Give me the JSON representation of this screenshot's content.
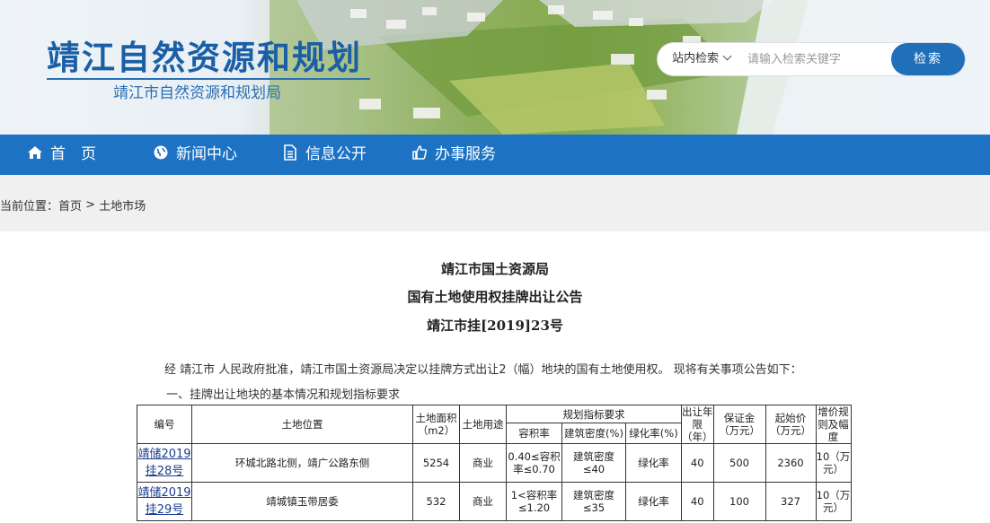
{
  "header": {
    "title": "靖江自然资源和规划",
    "subtitle": "靖江市自然资源和规划局"
  },
  "search": {
    "scope_label": "站内检索",
    "placeholder": "请输入检索关键字",
    "button_label": "检索"
  },
  "nav": {
    "items": [
      {
        "label": "首　页",
        "icon": "home-icon"
      },
      {
        "label": "新闻中心",
        "icon": "globe-icon"
      },
      {
        "label": "信息公开",
        "icon": "document-icon"
      },
      {
        "label": "办事服务",
        "icon": "thumbs-up-icon"
      }
    ]
  },
  "breadcrumb": {
    "prefix": "当前位置：",
    "home": "首页",
    "separator": ">",
    "current": "土地市场"
  },
  "article": {
    "issuer": "靖江市国土资源局",
    "title": "国有土地使用权挂牌出让公告",
    "doc_no": "靖江市挂[2019]23号",
    "intro": "经 靖江市 人民政府批准，靖江市国土资源局决定以挂牌方式出让2（幅）地块的国有土地使用权。 现将有关事项公告如下：",
    "section1": "一、挂牌出让地块的基本情况和规划指标要求"
  },
  "table": {
    "headers": {
      "id": "编号",
      "location": "土地位置",
      "area": "土地面积（m2）",
      "use": "土地用途",
      "planning": "规划指标要求",
      "plot_ratio": "容积率",
      "density": "建筑密度(%)",
      "green": "绿化率(%)",
      "term": "出让年限（年）",
      "deposit": "保证金（万元）",
      "start_price": "起始价（万元）",
      "increment": "增价规则及幅度"
    },
    "rows": [
      {
        "id_line1": "靖储2019",
        "id_line2": "挂28号",
        "location": "环城北路北侧，靖广公路东侧",
        "area": "5254",
        "use": "商业",
        "plot_ratio": "0.40≤容积率≤0.70",
        "density": "建筑密度≤40",
        "green": "绿化率",
        "term": "40",
        "deposit": "500",
        "start_price": "2360",
        "increment": "10（万元）"
      },
      {
        "id_line1": "靖储2019",
        "id_line2": "挂29号",
        "location": "靖城镇玉带居委",
        "area": "532",
        "use": "商业",
        "plot_ratio": "1<容积率≤1.20",
        "density": "建筑密度≤35",
        "green": "绿化率",
        "term": "40",
        "deposit": "100",
        "start_price": "327",
        "increment": "10（万元）"
      }
    ]
  }
}
